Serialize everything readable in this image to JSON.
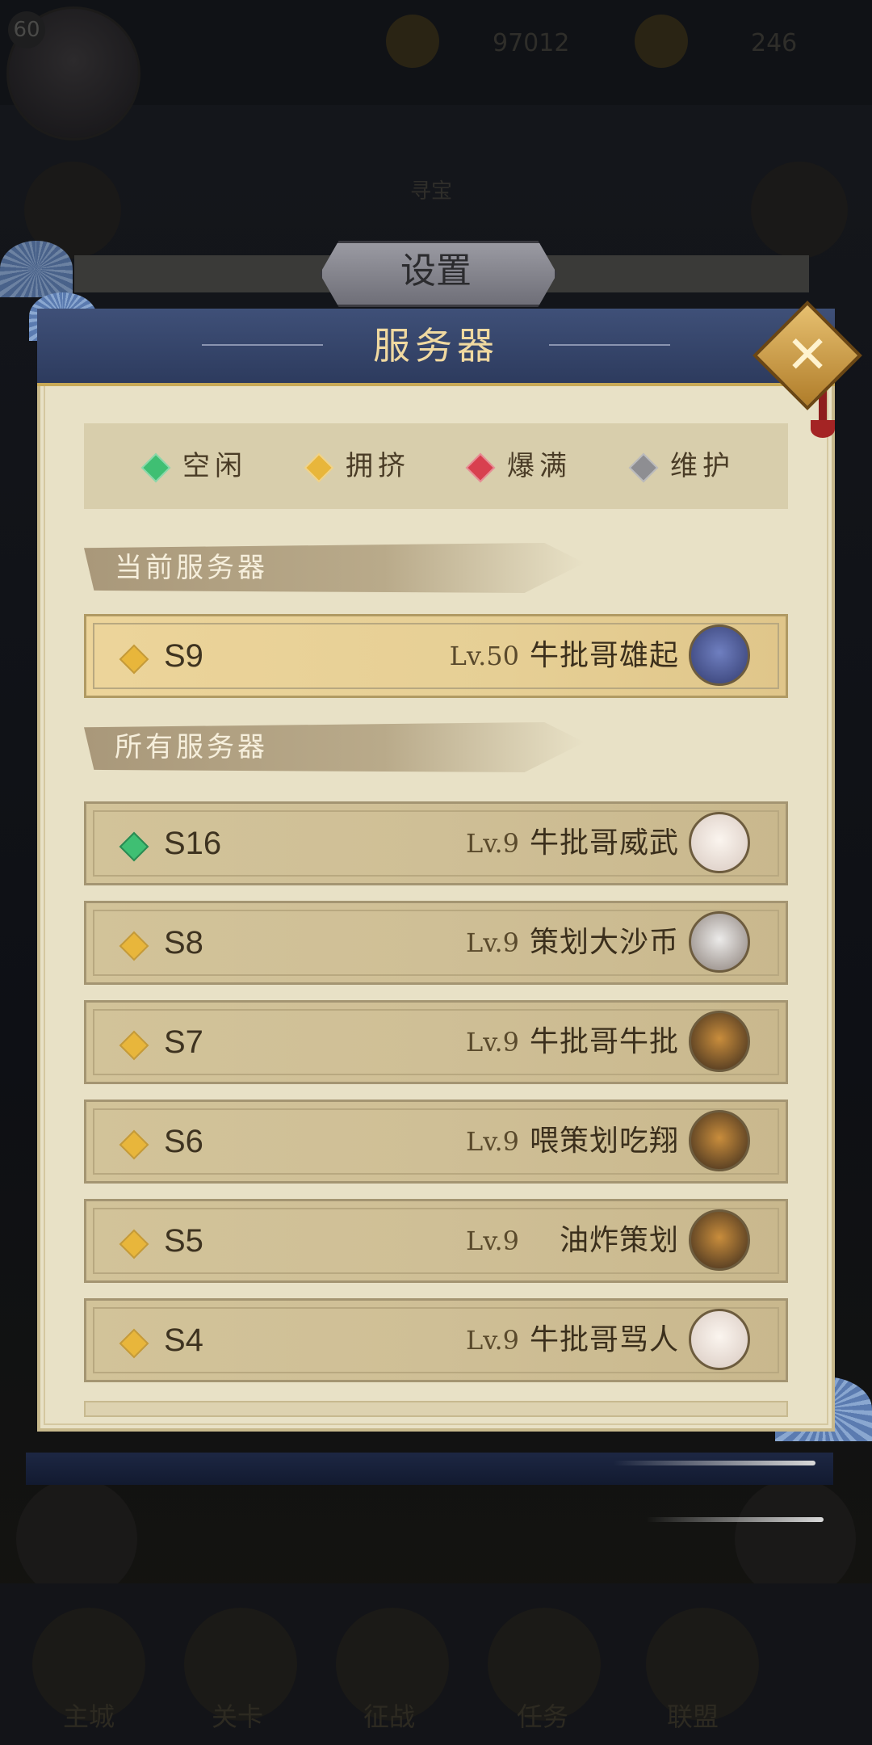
{
  "background": {
    "player_level": "60",
    "coins": "97012",
    "jade": "246",
    "center_label": "寻宝",
    "tabs": [
      "主城",
      "关卡",
      "征战",
      "任务",
      "联盟"
    ]
  },
  "dialog": {
    "back_title": "设置",
    "title": "服务器",
    "close_icon": "close-x-icon"
  },
  "legend": [
    {
      "label": "空闲",
      "color": "#3fbf73"
    },
    {
      "label": "拥挤",
      "color": "#e8b63b"
    },
    {
      "label": "爆满",
      "color": "#d8404f"
    },
    {
      "label": "维护",
      "color": "#8e8e92"
    }
  ],
  "sections": {
    "current": "当前服务器",
    "all": "所有服务器"
  },
  "current_server": {
    "id": "S9",
    "level": "Lv.50",
    "name": "牛批哥雄起",
    "status_color": "#e8b63b",
    "avatar_color": "#4a5a9a"
  },
  "servers": [
    {
      "id": "S16",
      "level": "Lv.9",
      "name": "牛批哥威武",
      "status_color": "#3fbf73",
      "avatar_color": "#efe6e0"
    },
    {
      "id": "S8",
      "level": "Lv.9",
      "name": "策划大沙币",
      "status_color": "#e8b63b",
      "avatar_color": "#d9d4d2"
    },
    {
      "id": "S7",
      "level": "Lv.9",
      "name": "牛批哥牛批",
      "status_color": "#e8b63b",
      "avatar_color": "#4a3a2c"
    },
    {
      "id": "S6",
      "level": "Lv.9",
      "name": "喂策划吃翔",
      "status_color": "#e8b63b",
      "avatar_color": "#4a3a2c"
    },
    {
      "id": "S5",
      "level": "Lv.9",
      "name": "油炸策划",
      "status_color": "#e8b63b",
      "avatar_color": "#4a3a2c"
    },
    {
      "id": "S4",
      "level": "Lv.9",
      "name": "牛批哥骂人",
      "status_color": "#e8b63b",
      "avatar_color": "#efe6e0"
    }
  ]
}
